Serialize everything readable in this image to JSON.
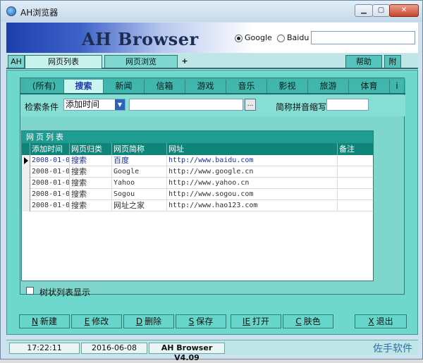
{
  "window": {
    "title": "AH浏览器",
    "min": "0",
    "max": "1",
    "close": "r"
  },
  "header": {
    "brand": "AH Browser",
    "engines": [
      "Google",
      "Baidu"
    ],
    "selected_engine": "Google",
    "search_value": ""
  },
  "top_tabs": {
    "ah": "AH",
    "list": "网页列表",
    "browse": "网页浏览",
    "plus": "+",
    "help": "帮助",
    "extra": "附"
  },
  "categories": [
    "(所有)",
    "搜索",
    "新闻",
    "信箱",
    "游戏",
    "音乐",
    "影视",
    "旅游",
    "体育",
    "i"
  ],
  "active_category": "搜索",
  "filter": {
    "cond_label": "检索条件",
    "cond_value": "添加时间",
    "cond_input": "",
    "browse_btn": "...",
    "py_label": "简称拼音缩写",
    "py_value": ""
  },
  "grid": {
    "caption": "网页列表",
    "columns": [
      "添加时间",
      "网页归类",
      "网页简称",
      "网址",
      "备注"
    ],
    "rows": [
      {
        "time": "2008-01-0",
        "type": "搜索",
        "name": "百度",
        "url": "http://www.baidu.com",
        "note": ""
      },
      {
        "time": "2008-01-0",
        "type": "搜索",
        "name": "Google",
        "url": "http://www.google.cn",
        "note": ""
      },
      {
        "time": "2008-01-0",
        "type": "搜索",
        "name": "Yahoo",
        "url": "http://www.yahoo.cn",
        "note": ""
      },
      {
        "time": "2008-01-0",
        "type": "搜索",
        "name": "Sogou",
        "url": "http://www.sogou.com",
        "note": ""
      },
      {
        "time": "2008-01-0",
        "type": "搜索",
        "name": "网址之家",
        "url": "http://www.hao123.com",
        "note": ""
      }
    ]
  },
  "tree_label": "树状列表显示",
  "buttons": [
    {
      "key": "N",
      "label": "新建"
    },
    {
      "key": "E",
      "label": "修改"
    },
    {
      "key": "D",
      "label": "删除"
    },
    {
      "key": "S",
      "label": "保存"
    },
    {
      "key": "IE",
      "label": "打开"
    },
    {
      "key": "C",
      "label": "肤色"
    },
    {
      "key": "X",
      "label": "退出"
    }
  ],
  "status": {
    "time": "17:22:11",
    "date": "2016-06-08",
    "version": "AH Browser V4.09",
    "brand": "佐手软件"
  }
}
